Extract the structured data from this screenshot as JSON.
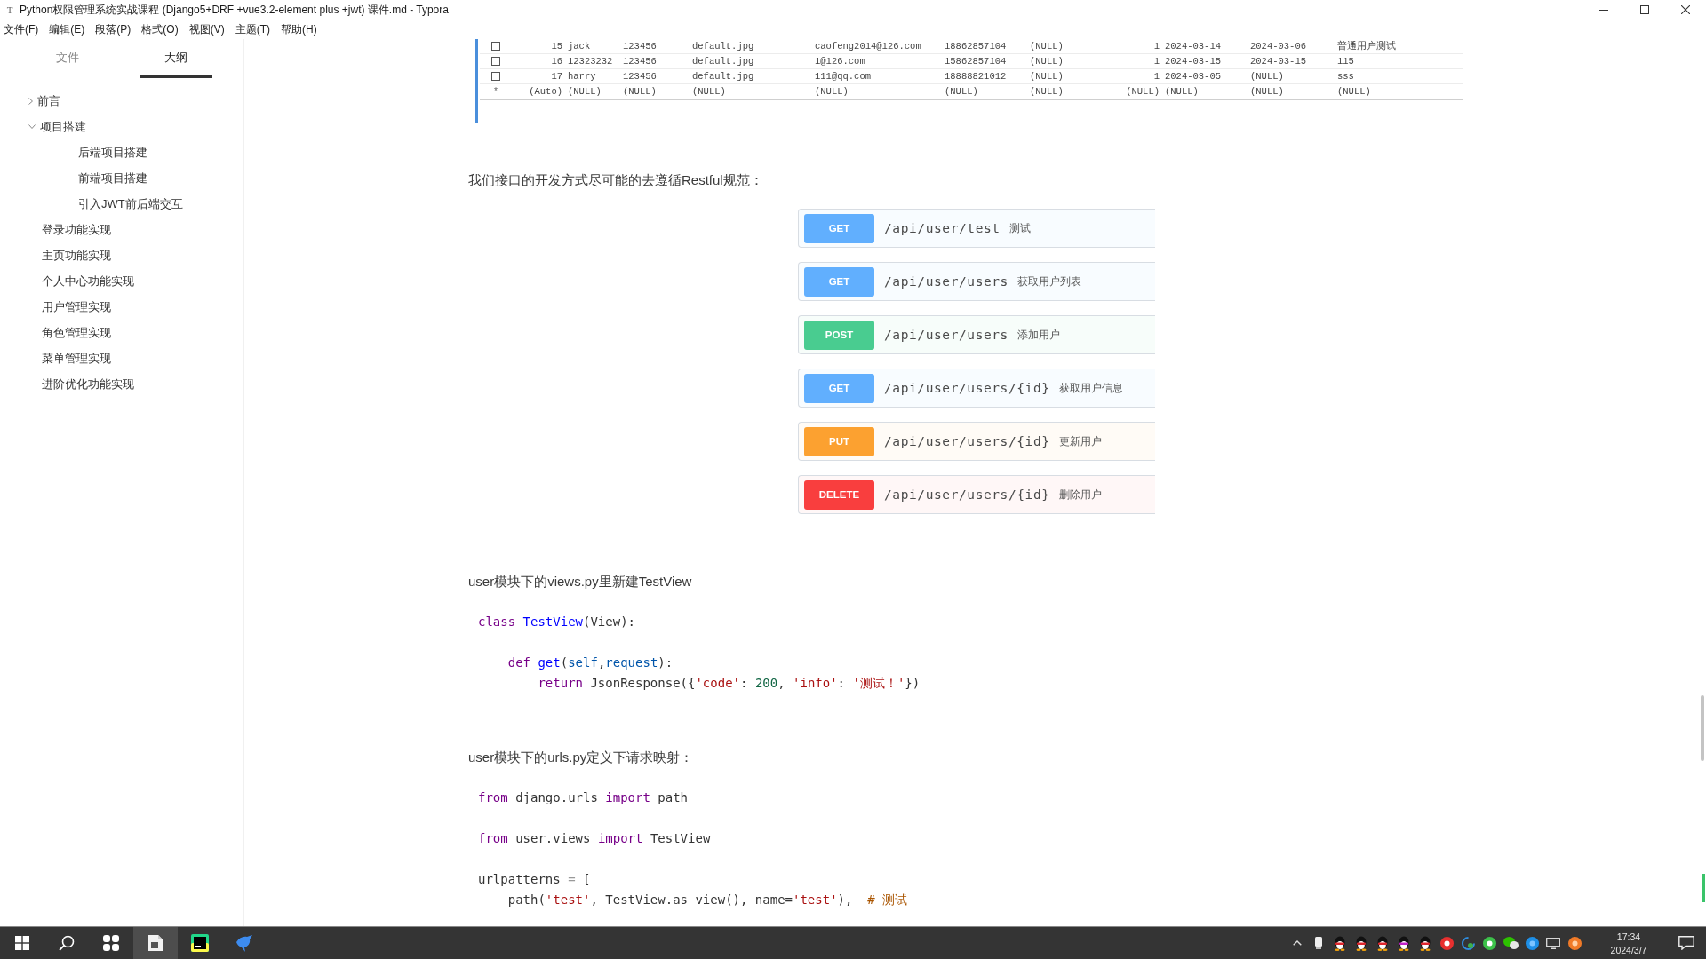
{
  "window": {
    "icon": "T",
    "title": "Python权限管理系统实战课程 (Django5+DRF +vue3.2-element plus +jwt) 课件.md - Typora"
  },
  "menu": [
    "文件(F)",
    "编辑(E)",
    "段落(P)",
    "格式(O)",
    "视图(V)",
    "主题(T)",
    "帮助(H)"
  ],
  "sidebar": {
    "tabs": [
      {
        "label": "文件",
        "selected": false
      },
      {
        "label": "大纲",
        "selected": true
      }
    ],
    "outline": [
      {
        "kind": "group",
        "label": "前言",
        "expanded": false
      },
      {
        "kind": "group",
        "label": "项目搭建",
        "expanded": true,
        "children": [
          {
            "kind": "leaf",
            "label": "后端项目搭建"
          },
          {
            "kind": "leaf",
            "label": "前端项目搭建"
          },
          {
            "kind": "leaf",
            "label": "引入JWT前后端交互"
          }
        ]
      },
      {
        "kind": "leaf",
        "label": "登录功能实现"
      },
      {
        "kind": "leaf",
        "label": "主页功能实现"
      },
      {
        "kind": "leaf",
        "label": "个人中心功能实现"
      },
      {
        "kind": "leaf",
        "label": "用户管理实现"
      },
      {
        "kind": "leaf",
        "label": "角色管理实现"
      },
      {
        "kind": "leaf",
        "label": "菜单管理实现"
      },
      {
        "kind": "leaf",
        "label": "进阶优化功能实现"
      }
    ]
  },
  "document": {
    "blocks": [
      {
        "kind": "table",
        "rows": [
          {
            "kind": "record",
            "checked": false,
            "cells": [
              "15",
              "jack",
              "123456",
              "default.jpg",
              "caofeng2014@126.com",
              "18862857104",
              "(NULL)",
              "1",
              "2024-03-14",
              "2024-03-06",
              "普通用户测试"
            ]
          },
          {
            "kind": "record",
            "checked": false,
            "cells": [
              "16",
              "12323232",
              "123456",
              "default.jpg",
              "1@126.com",
              "15862857104",
              "(NULL)",
              "1",
              "2024-03-15",
              "2024-03-15",
              "115"
            ]
          },
          {
            "kind": "record",
            "checked": false,
            "cells": [
              "17",
              "harry",
              "123456",
              "default.jpg",
              "111@qq.com",
              "18888821012",
              "(NULL)",
              "1",
              "2024-03-05",
              "(NULL)",
              "sss"
            ]
          },
          {
            "kind": "new",
            "marker": "*",
            "cells": [
              "(Auto)",
              "(NULL)",
              "(NULL)",
              "(NULL)",
              "(NULL)",
              "(NULL)",
              "(NULL)",
              "(NULL)",
              "(NULL)",
              "(NULL)",
              "(NULL)"
            ]
          }
        ]
      },
      {
        "kind": "paragraph",
        "text": "我们接口的开发方式尽可能的去遵循Restful规范："
      },
      {
        "kind": "endpoints",
        "items": [
          {
            "method": "GET",
            "path": "/api/user/test",
            "description": "测试",
            "color": "#61affe"
          },
          {
            "method": "GET",
            "path": "/api/user/users",
            "description": "获取用户列表",
            "color": "#61affe"
          },
          {
            "method": "POST",
            "path": "/api/user/users",
            "description": "添加用户",
            "color": "#49cc90"
          },
          {
            "method": "GET",
            "path": "/api/user/users/{id}",
            "description": "获取用户信息",
            "color": "#61affe"
          },
          {
            "method": "PUT",
            "path": "/api/user/users/{id}",
            "description": "更新用户",
            "color": "#fca130"
          },
          {
            "method": "DELETE",
            "path": "/api/user/users/{id}",
            "description": "删除用户",
            "color": "#f93e3e"
          }
        ]
      },
      {
        "kind": "paragraph",
        "text": "user模块下的views.py里新建TestView"
      },
      {
        "kind": "code",
        "lines": [
          {
            "kind": "code",
            "tokens": [
              {
                "kind": "keyword",
                "text": "class"
              },
              {
                "kind": "def",
                "text": " TestView"
              },
              {
                "kind": "plain",
                "text": "(View):"
              }
            ],
            "children": [
              {
                "kind": "blank"
              },
              {
                "kind": "code",
                "tokens": [
                  {
                    "kind": "keyword",
                    "text": "def"
                  },
                  {
                    "kind": "def",
                    "text": " get"
                  },
                  {
                    "kind": "plain",
                    "text": "("
                  },
                  {
                    "kind": "variable",
                    "text": "self"
                  },
                  {
                    "kind": "plain",
                    "text": ","
                  },
                  {
                    "kind": "variable",
                    "text": "request"
                  },
                  {
                    "kind": "plain",
                    "text": "):"
                  }
                ],
                "children": [
                  {
                    "kind": "code",
                    "tokens": [
                      {
                        "kind": "keyword",
                        "text": "return"
                      },
                      {
                        "kind": "plain",
                        "text": " JsonResponse({"
                      },
                      {
                        "kind": "string",
                        "text": "'code'"
                      },
                      {
                        "kind": "plain",
                        "text": ": "
                      },
                      {
                        "kind": "number",
                        "text": "200"
                      },
                      {
                        "kind": "plain",
                        "text": ", "
                      },
                      {
                        "kind": "string",
                        "text": "'info'"
                      },
                      {
                        "kind": "plain",
                        "text": ": "
                      },
                      {
                        "kind": "string",
                        "text": "'测试！'"
                      },
                      {
                        "kind": "plain",
                        "text": "})"
                      }
                    ]
                  }
                ]
              }
            ]
          }
        ]
      },
      {
        "kind": "paragraph",
        "text": "user模块下的urls.py定义下请求映射："
      },
      {
        "kind": "code",
        "lines": [
          {
            "kind": "code",
            "tokens": [
              {
                "kind": "keyword",
                "text": "from"
              },
              {
                "kind": "plain",
                "text": " django.urls "
              },
              {
                "kind": "keyword",
                "text": "import"
              },
              {
                "kind": "plain",
                "text": " path"
              }
            ]
          },
          {
            "kind": "blank"
          },
          {
            "kind": "code",
            "tokens": [
              {
                "kind": "keyword",
                "text": "from"
              },
              {
                "kind": "plain",
                "text": " user.views "
              },
              {
                "kind": "keyword",
                "text": "import"
              },
              {
                "kind": "plain",
                "text": " TestView"
              }
            ]
          },
          {
            "kind": "blank"
          },
          {
            "kind": "code",
            "tokens": [
              {
                "kind": "plain",
                "text": "urlpatterns "
              },
              {
                "kind": "operator",
                "text": "="
              },
              {
                "kind": "plain",
                "text": " ["
              }
            ],
            "children": [
              {
                "kind": "code",
                "tokens": [
                  {
                    "kind": "plain",
                    "text": "path("
                  },
                  {
                    "kind": "string",
                    "text": "'test'"
                  },
                  {
                    "kind": "plain",
                    "text": ", TestView.as_view(), name="
                  },
                  {
                    "kind": "string",
                    "text": "'test'"
                  },
                  {
                    "kind": "plain",
                    "text": "),  "
                  },
                  {
                    "kind": "comment",
                    "text": "# 测试"
                  }
                ]
              }
            ]
          }
        ]
      }
    ]
  },
  "taskbar": {
    "apps": [
      {
        "kind": "tiles",
        "highlighted": false
      },
      {
        "kind": "document",
        "highlighted": true
      },
      {
        "kind": "ide",
        "highlighted": false
      },
      {
        "kind": "bird",
        "highlighted": false
      }
    ],
    "time": "17:34",
    "date": "2024/3/7"
  }
}
